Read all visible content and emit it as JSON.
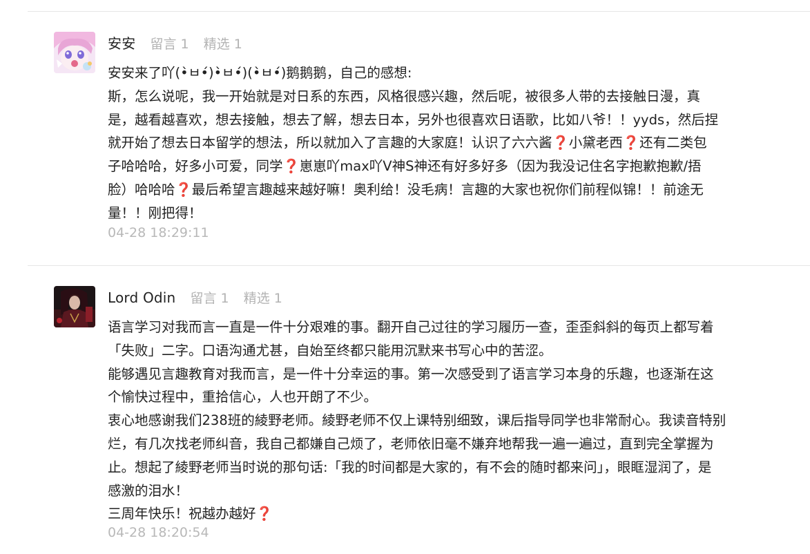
{
  "comments": [
    {
      "username": "安安",
      "messages": "留言 1",
      "featured": "精选 1",
      "lines": [
        "安安来了吖(•̀ㅂ•́)•̀ㅂ•́)(•̀ㅂ•́)鹅鹅鹅，自己的感想:",
        "斯，怎么说呢，我一开始就是对日系的东西，风格很感兴趣，然后呢，被很多人带的去接触日漫，真",
        "是，越看越喜欢，想去接触，想去了解，想去日本，另外也很喜欢日语歌，比如八爷！！yyds，然后捏",
        "就开始了想去日本留学的想法，所以就加入了言趣的大家庭！认识了六六酱❓小黛老西❓还有二类包",
        "子哈哈哈，好多小可爱，同学❓崽崽吖max吖V神S神还有好多好多（因为我没记住名字抱歉抱歉/捂",
        "脸）哈哈哈❓最后希望言趣越来越好嘛！奥利给！没毛病！言趣的大家也祝你们前程似锦！！前途无",
        "量！！刚把得！"
      ],
      "time": "04-28 18:29:11"
    },
    {
      "username": "Lord Odin",
      "messages": "留言 1",
      "featured": "精选 1",
      "lines": [
        "语言学习对我而言一直是一件十分艰难的事。翻开自己过往的学习履历一查，歪歪斜斜的每页上都写着",
        "「失败」二字。口语沟通尤甚，自始至终都只能用沉默来书写心中的苦涩。",
        "能够遇见言趣教育对我而言，是一件十分幸运的事。第一次感受到了语言学习本身的乐趣，也逐渐在这",
        "个愉快过程中，重拾信心，人也开朗了不少。",
        "衷心地感谢我们238班的綾野老师。綾野老师不仅上课特别细致，课后指导同学也非常耐心。我读音特别",
        "烂，有几次找老师纠音，我自己都嫌自己烦了，老师依旧毫不嫌弃地帮我一遍一遍过，直到完全掌握为",
        "止。想起了綾野老师当时说的那句话:「我的时间都是大家的，有不会的随时都来问」，眼眶湿润了，是",
        "感激的泪水！",
        "三周年快乐！祝越办越好❓"
      ],
      "time": "04-28 18:20:54"
    }
  ]
}
